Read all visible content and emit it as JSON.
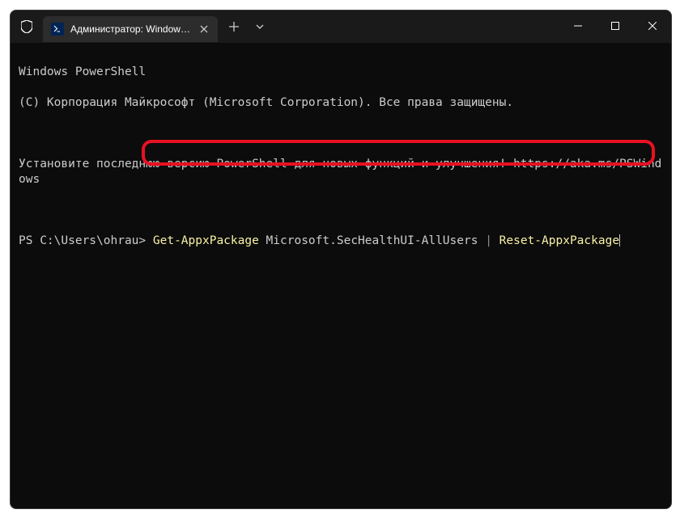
{
  "tab": {
    "title": "Администратор: Windows Po"
  },
  "ps": {
    "line1": "Windows PowerShell",
    "line2": "(C) Корпорация Майкрософт (Microsoft Corporation). Все права защищены.",
    "line3": "Установите последнюю версию PowerShell для новых функций и улучшения! https://aka.ms/PSWindows",
    "prompt": "PS C:\\Users\\ohrau> ",
    "cmd_p1": "Get-AppxPackage",
    "cmd_p2": " Microsoft.SecHealthUI-AllUsers ",
    "cmd_p3": "|",
    "cmd_p4": " ",
    "cmd_p5": "Reset-AppxPackage"
  }
}
